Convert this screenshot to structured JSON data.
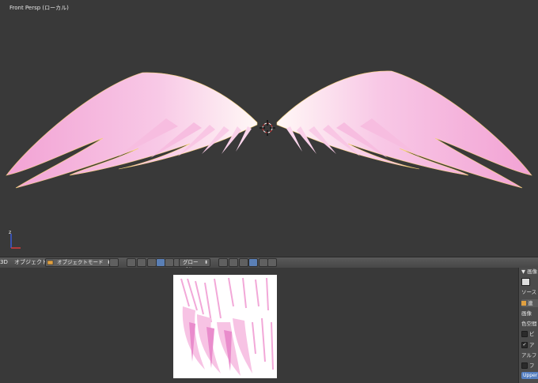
{
  "viewport": {
    "label": "Front Persp (ローカル)"
  },
  "header": {
    "editor_type_fragment": "3D",
    "object_menu": "オブジェクト",
    "mode_dropdown": "オブジェクトモード",
    "orientation_dropdown": "グローバル"
  },
  "properties": {
    "panel_title": "画像",
    "source_label": "ソース",
    "row_a": "連",
    "image_label": "画像",
    "colorspace_label": "色空間",
    "checkbox_1": "ビ",
    "checkbox_2": "ア",
    "alpha_label": "アルフ",
    "checkbox_3": "フ",
    "upper_button": "Upper"
  },
  "colors": {
    "viewport_bg": "#393939",
    "wing_tip": "#f4a9d6",
    "wing_base": "#fff4f4",
    "outline": "#ffb800",
    "active_button": "#5a7fb5"
  }
}
